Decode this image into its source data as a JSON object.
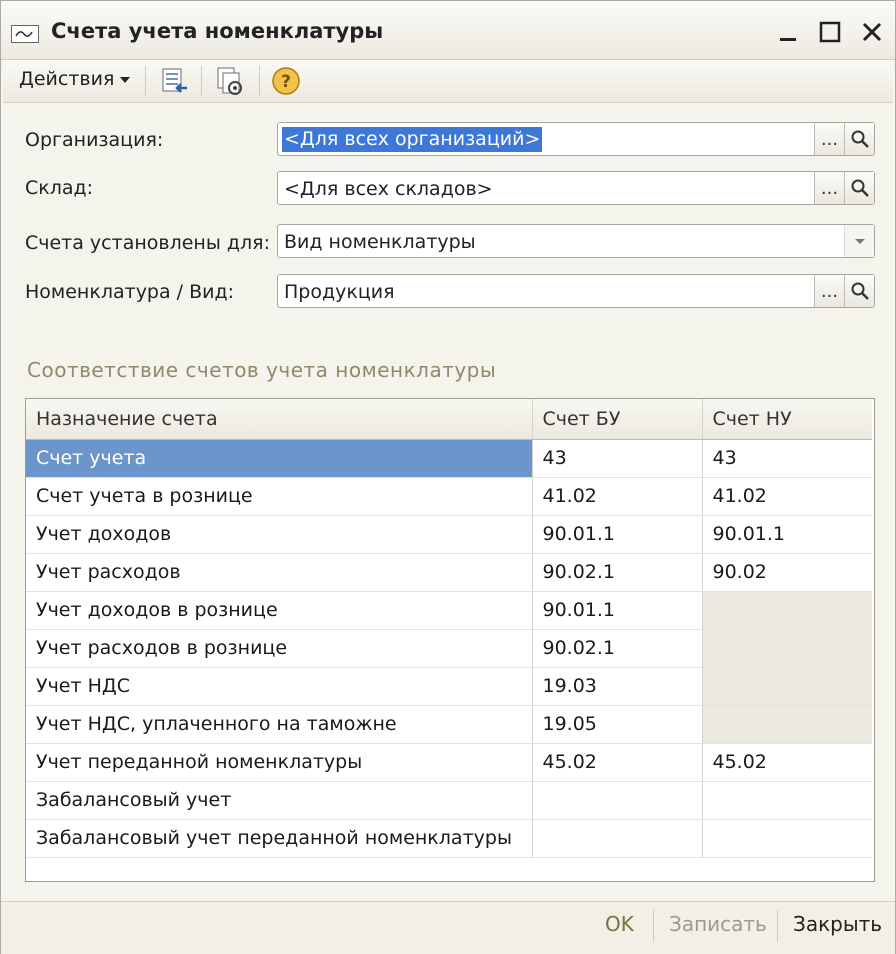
{
  "window": {
    "title": "Счета учета номенклатуры",
    "controls": [
      "minimize-icon",
      "maximize-icon",
      "close-icon"
    ]
  },
  "toolbar": {
    "actions_label": "Действия",
    "icons": [
      "list-export-icon",
      "copy-settings-icon",
      "help-icon"
    ]
  },
  "form": {
    "organization": {
      "label": "Организация:",
      "value": "<Для всех организаций>"
    },
    "warehouse": {
      "label": "Склад:",
      "value": "<Для всех складов>"
    },
    "accounts_for": {
      "label": "Счета установлены для:",
      "value": "Вид номенклатуры"
    },
    "item_kind": {
      "label": "Номенклатура / Вид:",
      "value": "Продукция"
    },
    "select_button": "..."
  },
  "section": {
    "title": "Соответствие счетов учета номенклатуры"
  },
  "table": {
    "columns": [
      "Назначение счета",
      "Счет БУ",
      "Счет НУ"
    ],
    "rows": [
      [
        "Счет учета",
        "43",
        "43"
      ],
      [
        "Счет учета в рознице",
        "41.02",
        "41.02"
      ],
      [
        "Учет доходов",
        "90.01.1",
        "90.01.1"
      ],
      [
        "Учет расходов",
        "90.02.1",
        "90.02"
      ],
      [
        "Учет доходов в рознице",
        "90.01.1",
        ""
      ],
      [
        "Учет расходов в рознице",
        "90.02.1",
        ""
      ],
      [
        "Учет НДС",
        "19.03",
        ""
      ],
      [
        "Учет НДС, уплаченного на таможне",
        "19.05",
        ""
      ],
      [
        "Учет переданной номенклатуры",
        "45.02",
        "45.02"
      ],
      [
        "Забалансовый учет",
        "",
        ""
      ],
      [
        "Забалансовый учет переданной номенклатуры",
        "",
        ""
      ]
    ],
    "selected_row": 0,
    "disabled_nu_rows": [
      4,
      5,
      6,
      7
    ]
  },
  "footer": {
    "ok_label": "OK",
    "save_label": "Записать",
    "close_label": "Закрыть"
  },
  "colors": {
    "selection": "#3d78d8",
    "row_selection": "#6c95cc",
    "section_title": "#8f8a6b",
    "ok_text": "#7a7140",
    "disabled_text": "#9a9a9a"
  }
}
